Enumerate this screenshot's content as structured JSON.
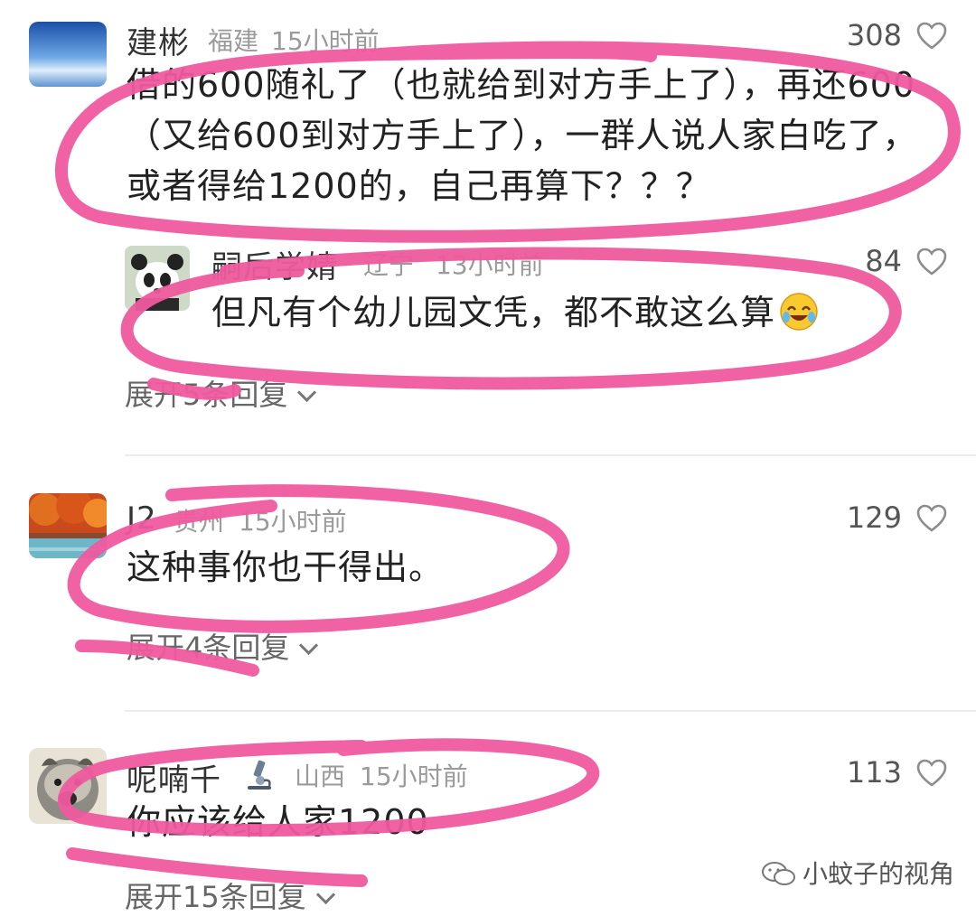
{
  "comments": [
    {
      "username": "建彬",
      "location": "福建",
      "time": "15小时前",
      "likes": "308",
      "text": "借的600随礼了（也就给到对方手上了），再还600（又给600到对方手上了），一群人说人家白吃了，或者得给1200的，自己再算下？？？",
      "reply": {
        "username": "嗣后学婧",
        "location": "辽宁",
        "time": "13小时前",
        "likes": "84",
        "text": "但凡有个幼儿园文凭，都不敢这么算"
      },
      "expand": "展开5条回复"
    },
    {
      "username": "J2",
      "location": "贵州",
      "time": "15小时前",
      "likes": "129",
      "text": "这种事你也干得出。",
      "expand": "展开4条回复"
    },
    {
      "username": "呢喃千",
      "location": "山西",
      "time": "15小时前",
      "likes": "113",
      "text": "你应该给人家1200",
      "expand": "展开15条回复"
    }
  ],
  "watermark": "小蚊子的视角",
  "icons": {
    "heart": "heart-outline-icon",
    "chevron": "chevron-down-icon",
    "microscope": "microscope-icon",
    "emoji": "laughing-crying-emoji",
    "wechat": "wechat-icon"
  },
  "colors": {
    "highlight": "#ef5a9e",
    "meta": "#9a9a9a"
  }
}
